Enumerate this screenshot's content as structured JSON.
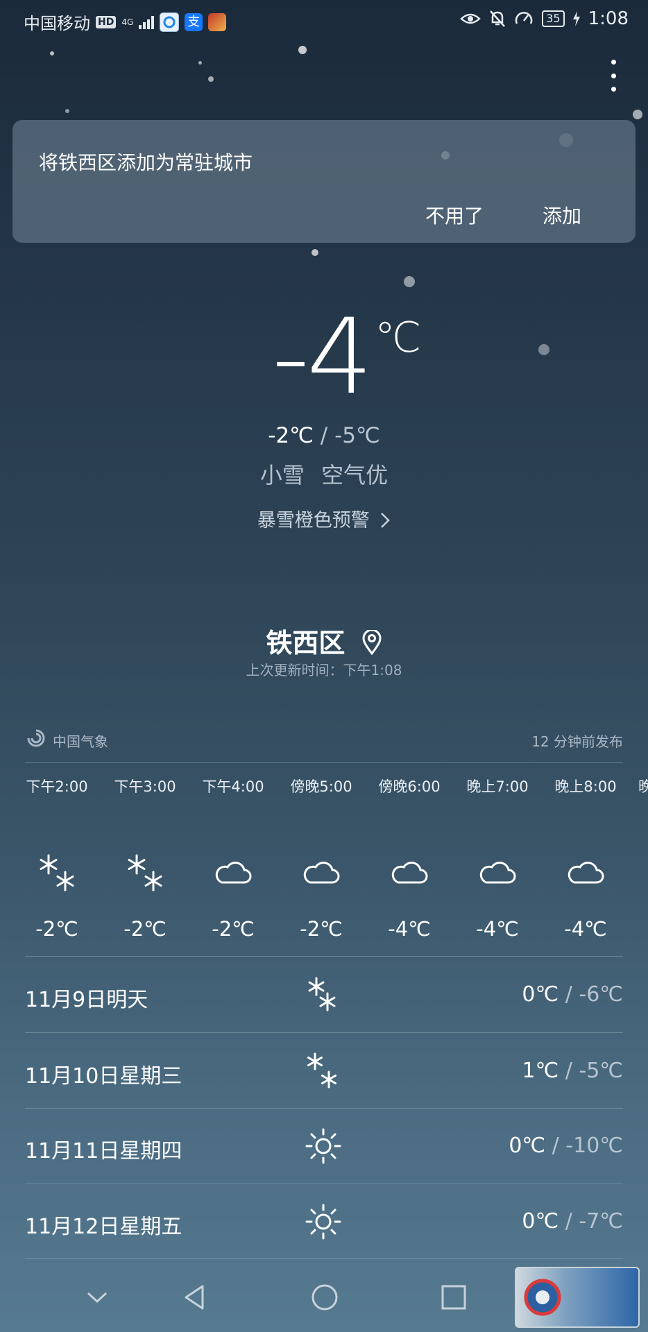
{
  "status_bar": {
    "carrier": "中国移动",
    "hd": "HD",
    "network": "4G",
    "battery": "35",
    "time": "1:08"
  },
  "add_city": {
    "message": "将铁西区添加为常驻城市",
    "dismiss": "不用了",
    "add": "添加"
  },
  "current": {
    "temp": "-4",
    "unit": "℃",
    "high": "-2℃",
    "sep": " / ",
    "low": "-5℃",
    "condition": "小雪 空气优",
    "alert": "暴雪橙色预警"
  },
  "location": {
    "city": "铁西区",
    "updated": "上次更新时间：下午1:08"
  },
  "source": {
    "name": "中国气象",
    "published": "12 分钟前发布"
  },
  "hourly": [
    {
      "time": "下午2:00",
      "icon": "snow-icon",
      "temp": "-2℃"
    },
    {
      "time": "下午3:00",
      "icon": "snow-icon",
      "temp": "-2℃"
    },
    {
      "time": "下午4:00",
      "icon": "cloud-icon",
      "temp": "-2℃"
    },
    {
      "time": "傍晚5:00",
      "icon": "cloud-icon",
      "temp": "-2℃"
    },
    {
      "time": "傍晚6:00",
      "icon": "cloud-icon",
      "temp": "-4℃"
    },
    {
      "time": "晚上7:00",
      "icon": "cloud-icon",
      "temp": "-4℃"
    },
    {
      "time": "晚上8:00",
      "icon": "cloud-icon",
      "temp": "-4℃"
    },
    {
      "time": "晚",
      "icon": "",
      "temp": ""
    }
  ],
  "daily": [
    {
      "date": "11月9日明天",
      "icon": "snow-icon",
      "high": "0℃",
      "low": "-6℃"
    },
    {
      "date": "11月10日星期三",
      "icon": "snow-icon",
      "high": "1℃",
      "low": "-5℃"
    },
    {
      "date": "11月11日星期四",
      "icon": "sun-icon",
      "high": "0℃",
      "low": "-10℃"
    },
    {
      "date": "11月12日星期五",
      "icon": "sun-icon",
      "high": "0℃",
      "low": "-7℃"
    }
  ],
  "colors": {
    "bg_top": "#1b2a3a",
    "bg_bottom": "#567a90",
    "card": "#5c7080"
  }
}
